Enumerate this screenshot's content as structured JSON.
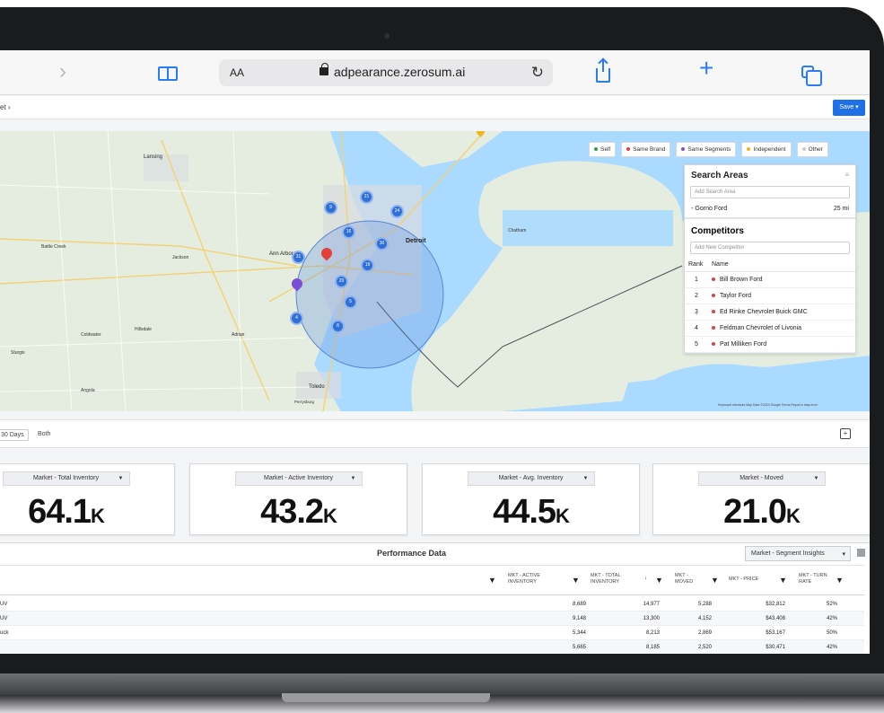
{
  "browser": {
    "text_size_label": "AA",
    "url": "adpearance.zerosum.ai"
  },
  "app": {
    "breadcrumb": "et ›",
    "save_label": "Save ▾"
  },
  "map": {
    "legend": [
      {
        "label": "Self",
        "color": "#2e9e48"
      },
      {
        "label": "Same Brand",
        "color": "#e0413a"
      },
      {
        "label": "Same Segments",
        "color": "#7a4fd6"
      },
      {
        "label": "Independent",
        "color": "#f2b320"
      },
      {
        "label": "Other",
        "color": "#c8cbd0"
      }
    ],
    "place_labels": [
      "Lansing",
      "Battle Creek",
      "Jackson",
      "Ann Arbor",
      "Detroit",
      "Coldwater",
      "Hillsdale",
      "Adrian",
      "Toledo",
      "Sturgis",
      "Angola",
      "Chatham",
      "Perrysburg"
    ],
    "clusters": [
      "9",
      "21",
      "24",
      "16",
      "30",
      "31",
      "19",
      "20",
      "5",
      "4",
      "8"
    ],
    "attribution": "Keyboard shortcuts   Map Data ©2024 Google   Terms   Report a map error"
  },
  "search_areas": {
    "title": "Search Areas",
    "input_placeholder": "Add Search Area",
    "areas": [
      {
        "name": "Gorno Ford",
        "radius": "25 mi"
      }
    ]
  },
  "competitors": {
    "title": "Competitors",
    "input_placeholder": "Add New Competitor",
    "col_rank": "Rank",
    "col_name": "Name",
    "rows": [
      {
        "rank": "1",
        "name": "Bill Brown Ford"
      },
      {
        "rank": "2",
        "name": "Taylor Ford"
      },
      {
        "rank": "3",
        "name": "Ed Rinke Chevrolet Buick GMC"
      },
      {
        "rank": "4",
        "name": "Feldman Chevrolet of Livonia"
      },
      {
        "rank": "5",
        "name": "Pat Milliken Ford"
      }
    ]
  },
  "filters": {
    "period": "30 Days",
    "condition": "Both"
  },
  "kpis": [
    {
      "label": "Market - Total Inventory",
      "value": "64.1",
      "unit": "K"
    },
    {
      "label": "Market - Active Inventory",
      "value": "43.2",
      "unit": "K"
    },
    {
      "label": "Market - Avg. Inventory",
      "value": "44.5",
      "unit": "K"
    },
    {
      "label": "Market - Moved",
      "value": "21.0",
      "unit": "K"
    }
  ],
  "performance": {
    "title": "Performance Data",
    "view_select": "Market - Segment Insights",
    "columns": [
      "MKT - ACTIVE INVENTORY",
      "MKT - TOTAL INVENTORY",
      "MKT - MOVED",
      "MKT - PRICE",
      "MKT - TURN RATE"
    ],
    "rows": [
      {
        "name": "UV",
        "active": "8,689",
        "total": "14,977",
        "moved": "5,288",
        "price": "$32,812",
        "turn": "52%"
      },
      {
        "name": "UV",
        "active": "9,148",
        "total": "13,300",
        "moved": "4,152",
        "price": "$43,408",
        "turn": "42%"
      },
      {
        "name": "uck",
        "active": "5,344",
        "total": "8,213",
        "moved": "2,869",
        "price": "$53,167",
        "turn": "50%"
      },
      {
        "name": "",
        "active": "5,665",
        "total": "8,185",
        "moved": "2,520",
        "price": "$30,471",
        "turn": "42%"
      }
    ]
  }
}
